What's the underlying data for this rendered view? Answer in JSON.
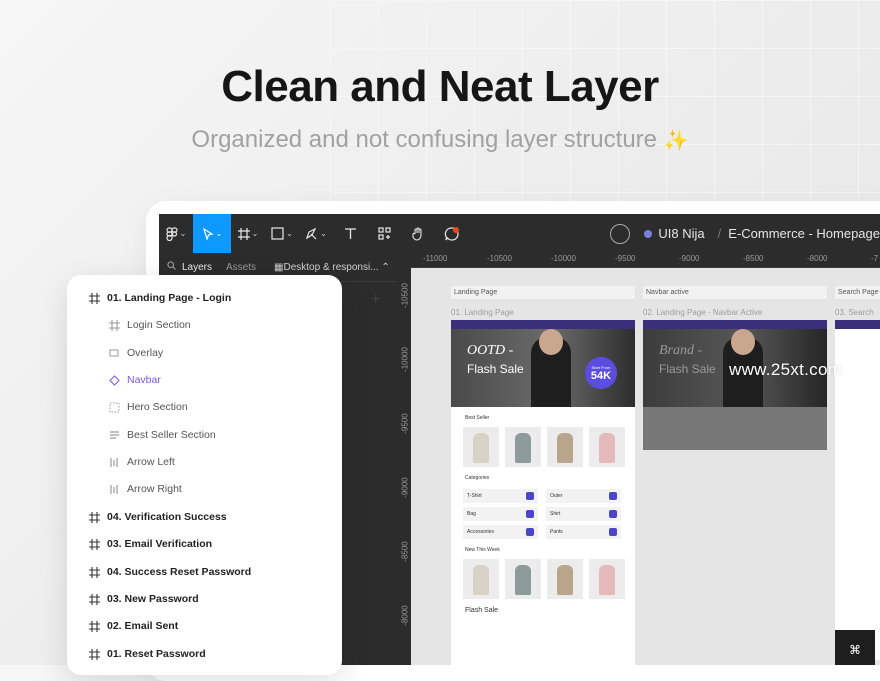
{
  "headline": "Clean and Neat Layer",
  "subheadline": "Organized and not confusing layer structure",
  "sparkle_glyph": "✨",
  "toolbar": {
    "team_name": "UI8 Nija",
    "file_name": "E-Commerce - Homepage",
    "separator": "/"
  },
  "left_panel": {
    "tabs": [
      "Layers",
      "Assets"
    ],
    "page_selector": "Desktop & responsi...",
    "page_icon": "grid-icon"
  },
  "rulers": {
    "top": [
      "-11000",
      "-10500",
      "-10000",
      "-9500",
      "-9000",
      "-8500",
      "-8000",
      "-7"
    ],
    "left": [
      "-10500",
      "-10000",
      "-9500",
      "-9000",
      "-8500",
      "-8000"
    ]
  },
  "canvas": {
    "frame_labels": [
      "Landing Page",
      "Navbar active",
      "Search Page"
    ],
    "frame_names": [
      "01. Landing Page",
      "02. Landing Page - Navbar Active",
      "03. Search"
    ],
    "hero_title": "OOTD -",
    "hero_subtitle": "Flash Sale",
    "hero_badge_small": "Start From",
    "hero_badge_value": "54K",
    "navbar_hero_title": "Brand -",
    "navbar_hero_subtitle": "Flash Sale",
    "best_seller": "Best Seller",
    "categories_heading": "Categories",
    "categories": [
      "T-Shirt",
      "Outer",
      "Bag",
      "Shirt",
      "Accessories",
      "Pants"
    ],
    "new_this_week": "New This Week",
    "flash_sale": "Flash Sale"
  },
  "watermark": "www.25xt.com",
  "layers": [
    {
      "label": "01. Landing Page - Login",
      "icon": "frame-icon",
      "level": "top"
    },
    {
      "label": "Login Section",
      "icon": "frame-icon",
      "level": "child"
    },
    {
      "label": "Overlay",
      "icon": "rectangle-icon",
      "level": "child"
    },
    {
      "label": "Navbar",
      "icon": "component-icon",
      "level": "child",
      "color": "#7a57e6"
    },
    {
      "label": "Hero Section",
      "icon": "dashed-frame-icon",
      "level": "child"
    },
    {
      "label": "Best Seller Section",
      "icon": "text-align-icon",
      "level": "child"
    },
    {
      "label": "Arrow Left",
      "icon": "columns-icon",
      "level": "child"
    },
    {
      "label": "Arrow Right",
      "icon": "columns-icon",
      "level": "child"
    },
    {
      "label": "04. Verification Success",
      "icon": "frame-icon",
      "level": "top"
    },
    {
      "label": "03. Email Verification",
      "icon": "frame-icon",
      "level": "top"
    },
    {
      "label": "04. Success Reset Password",
      "icon": "frame-icon",
      "level": "top"
    },
    {
      "label": "03. New Password",
      "icon": "frame-icon",
      "level": "top"
    },
    {
      "label": "02. Email Sent",
      "icon": "frame-icon",
      "level": "top"
    },
    {
      "label": "01. Reset Password",
      "icon": "frame-icon",
      "level": "top"
    }
  ],
  "colors": {
    "accent": "#0d99ff",
    "component_purple": "#7a57e6",
    "toolbar_bg": "#2c2c2c",
    "canvas_bg": "#e5e5e5"
  }
}
